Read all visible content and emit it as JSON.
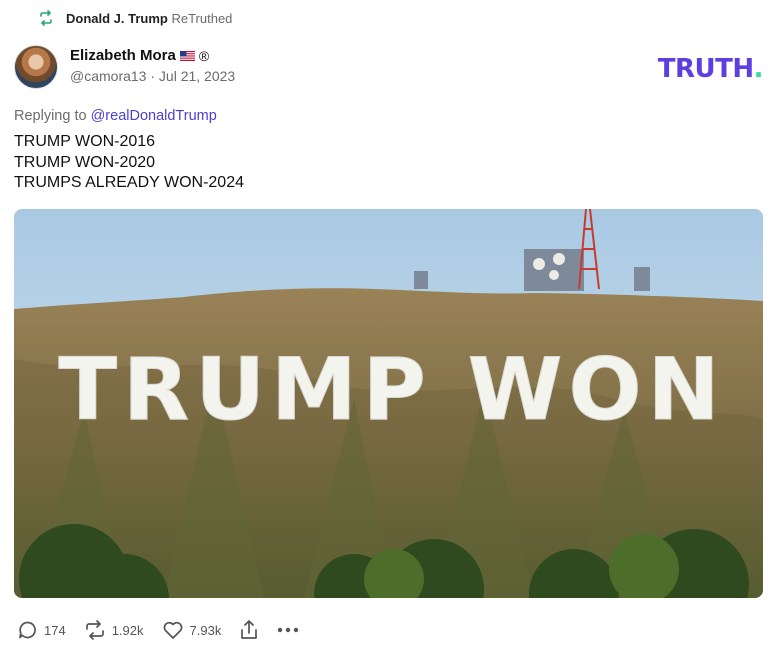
{
  "retruth": {
    "icon": "retruth-icon",
    "author": "Donald J. Trump",
    "action_label": "ReTruthed",
    "accent": "#22a96a"
  },
  "post": {
    "author_name": "Elizabeth Mora",
    "registered_mark": "®",
    "handle": "@camora13",
    "separator": "·",
    "date": "Jul 21, 2023",
    "reply_prefix": "Replying to",
    "reply_to": "@realDonaldTrump",
    "lines": [
      "TRUMP WON-2016",
      "TRUMP WON-2020",
      "TRUMPS ALREADY WON-2024"
    ],
    "image_sign_text": "TRUMP WON"
  },
  "logo": {
    "text": "TRUTH",
    "dot": ".",
    "color": "#5c3fe0",
    "dot_color": "#3ad6a6"
  },
  "actions": {
    "replies": "174",
    "retruths": "1.92k",
    "likes": "7.93k"
  },
  "icons": [
    "retruth-icon",
    "us-flag-icon",
    "reply-icon",
    "retruth-icon",
    "heart-icon",
    "share-icon",
    "more-icon"
  ]
}
